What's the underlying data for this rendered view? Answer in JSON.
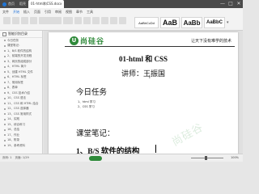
{
  "window": {
    "tabs": [
      {
        "label": "首页"
      },
      {
        "label": "稻壳"
      },
      {
        "label": "01-html和CSS.docx"
      }
    ],
    "controls": {
      "minimize": "—",
      "maximize": "□",
      "close": "✕"
    }
  },
  "ribbon": {
    "menu": [
      "文件",
      "开始",
      "插入",
      "页面",
      "引用",
      "审阅",
      "视图",
      "章节",
      "工具"
    ],
    "active_menu": "开始",
    "styles": [
      {
        "label": "AaBbCcDd"
      },
      {
        "label": "AaB"
      },
      {
        "label": "AaBb"
      },
      {
        "label": "AaBbC"
      }
    ]
  },
  "sidebar": {
    "title": "智能识别目录",
    "items": [
      "今日任务",
      "课堂笔记：",
      "1、B/S 软件的结构",
      "2、前端的开发流程",
      "3、网页的组成部分",
      "4、HTML 简介",
      "5、创建 HTML 文件",
      "6、HTML 标签",
      "7、常用标签",
      "8、表单",
      "9、CSS 技术介绍",
      "10、CSS 语法",
      "11、CSS 和 HTML 结合",
      "12、CSS 选择器",
      "13、CSS 常用样式",
      "14、实践",
      "15、综合练习",
      "16、总结",
      "17、作业",
      "18、附录",
      "19、参考资料"
    ]
  },
  "document": {
    "logo_glyph": "U",
    "logo_text": "尚硅谷",
    "slogan": "让天下没有难学的技术",
    "title": "01-html 和 CSS",
    "author": "讲师：王振国",
    "cursor_symbol": "I",
    "heading_today": "今日任务",
    "tasks": [
      "1、html 学习",
      "2、CSS 学习"
    ],
    "heading_notes": "课堂笔记：",
    "heading_bs": "1、B/S  软件的结构",
    "watermark": "尚硅谷"
  },
  "statusbar": {
    "page": "页码: 1",
    "pages": "页面: 1/29",
    "zoom": "100%"
  },
  "colors": {
    "brand_green": "#2f8a3a",
    "accent_blue": "#1c6ed8"
  }
}
